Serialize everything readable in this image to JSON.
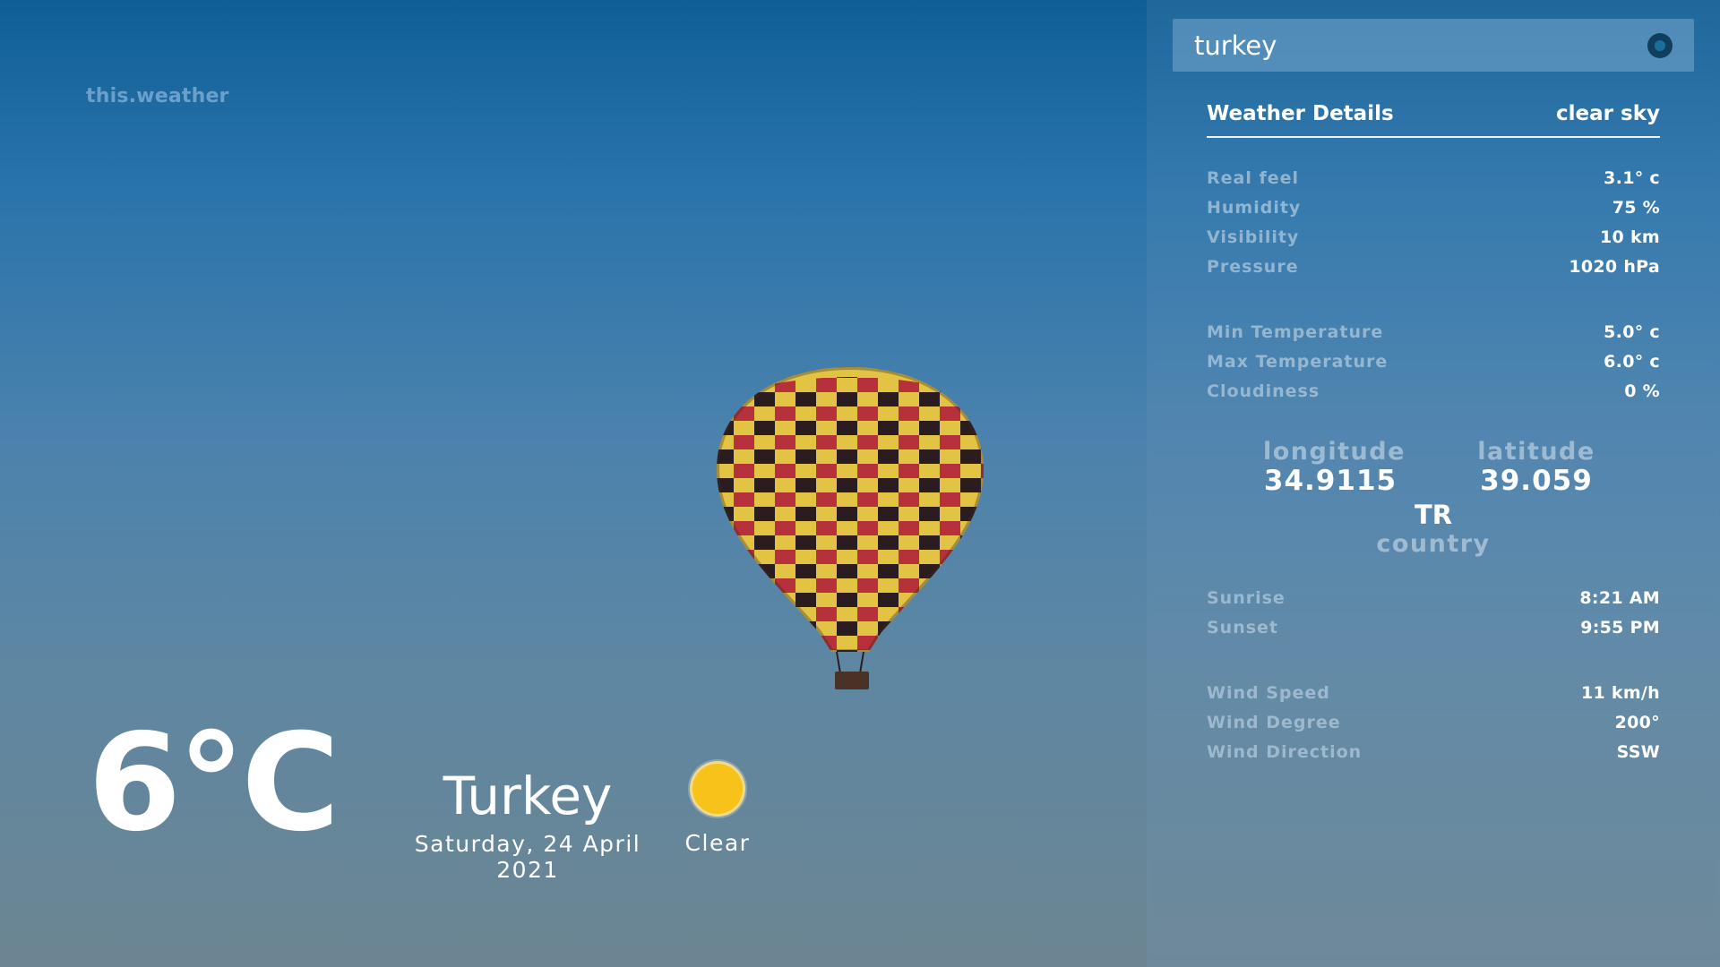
{
  "brand": "this.weather",
  "search": {
    "value": "turkey",
    "button_icon": "search-circle-icon"
  },
  "current": {
    "temperature": "6°C",
    "city": "Turkey",
    "date": "Saturday, 24 April 2021",
    "condition": "Clear",
    "condition_icon": "sun-icon"
  },
  "details": {
    "title": "Weather Details",
    "sky": "clear sky",
    "group1": [
      {
        "label": "Real feel",
        "value": "3.1° c"
      },
      {
        "label": "Humidity",
        "value": "75 %"
      },
      {
        "label": "Visibility",
        "value": "10 km"
      },
      {
        "label": "Pressure",
        "value": "1020 hPa"
      }
    ],
    "group2": [
      {
        "label": "Min Temperature",
        "value": "5.0° c"
      },
      {
        "label": "Max Temperature",
        "value": "6.0° c"
      },
      {
        "label": "Cloudiness",
        "value": "0 %"
      }
    ],
    "longitude_label": "longitude",
    "longitude_value": "34.9115",
    "latitude_label": "latitude",
    "latitude_value": "39.059",
    "country_code": "TR",
    "country_label": "country",
    "group3": [
      {
        "label": "Sunrise",
        "value": "8:21 AM"
      },
      {
        "label": "Sunset",
        "value": "9:55 PM"
      }
    ],
    "group4": [
      {
        "label": "Wind Speed",
        "value": "11 km/h"
      },
      {
        "label": "Wind Degree",
        "value": "200°"
      },
      {
        "label": "Wind Direction",
        "value": "SSW"
      }
    ]
  },
  "colors": {
    "sun": "#f7c21a",
    "search_button": "#0f3f5c"
  }
}
